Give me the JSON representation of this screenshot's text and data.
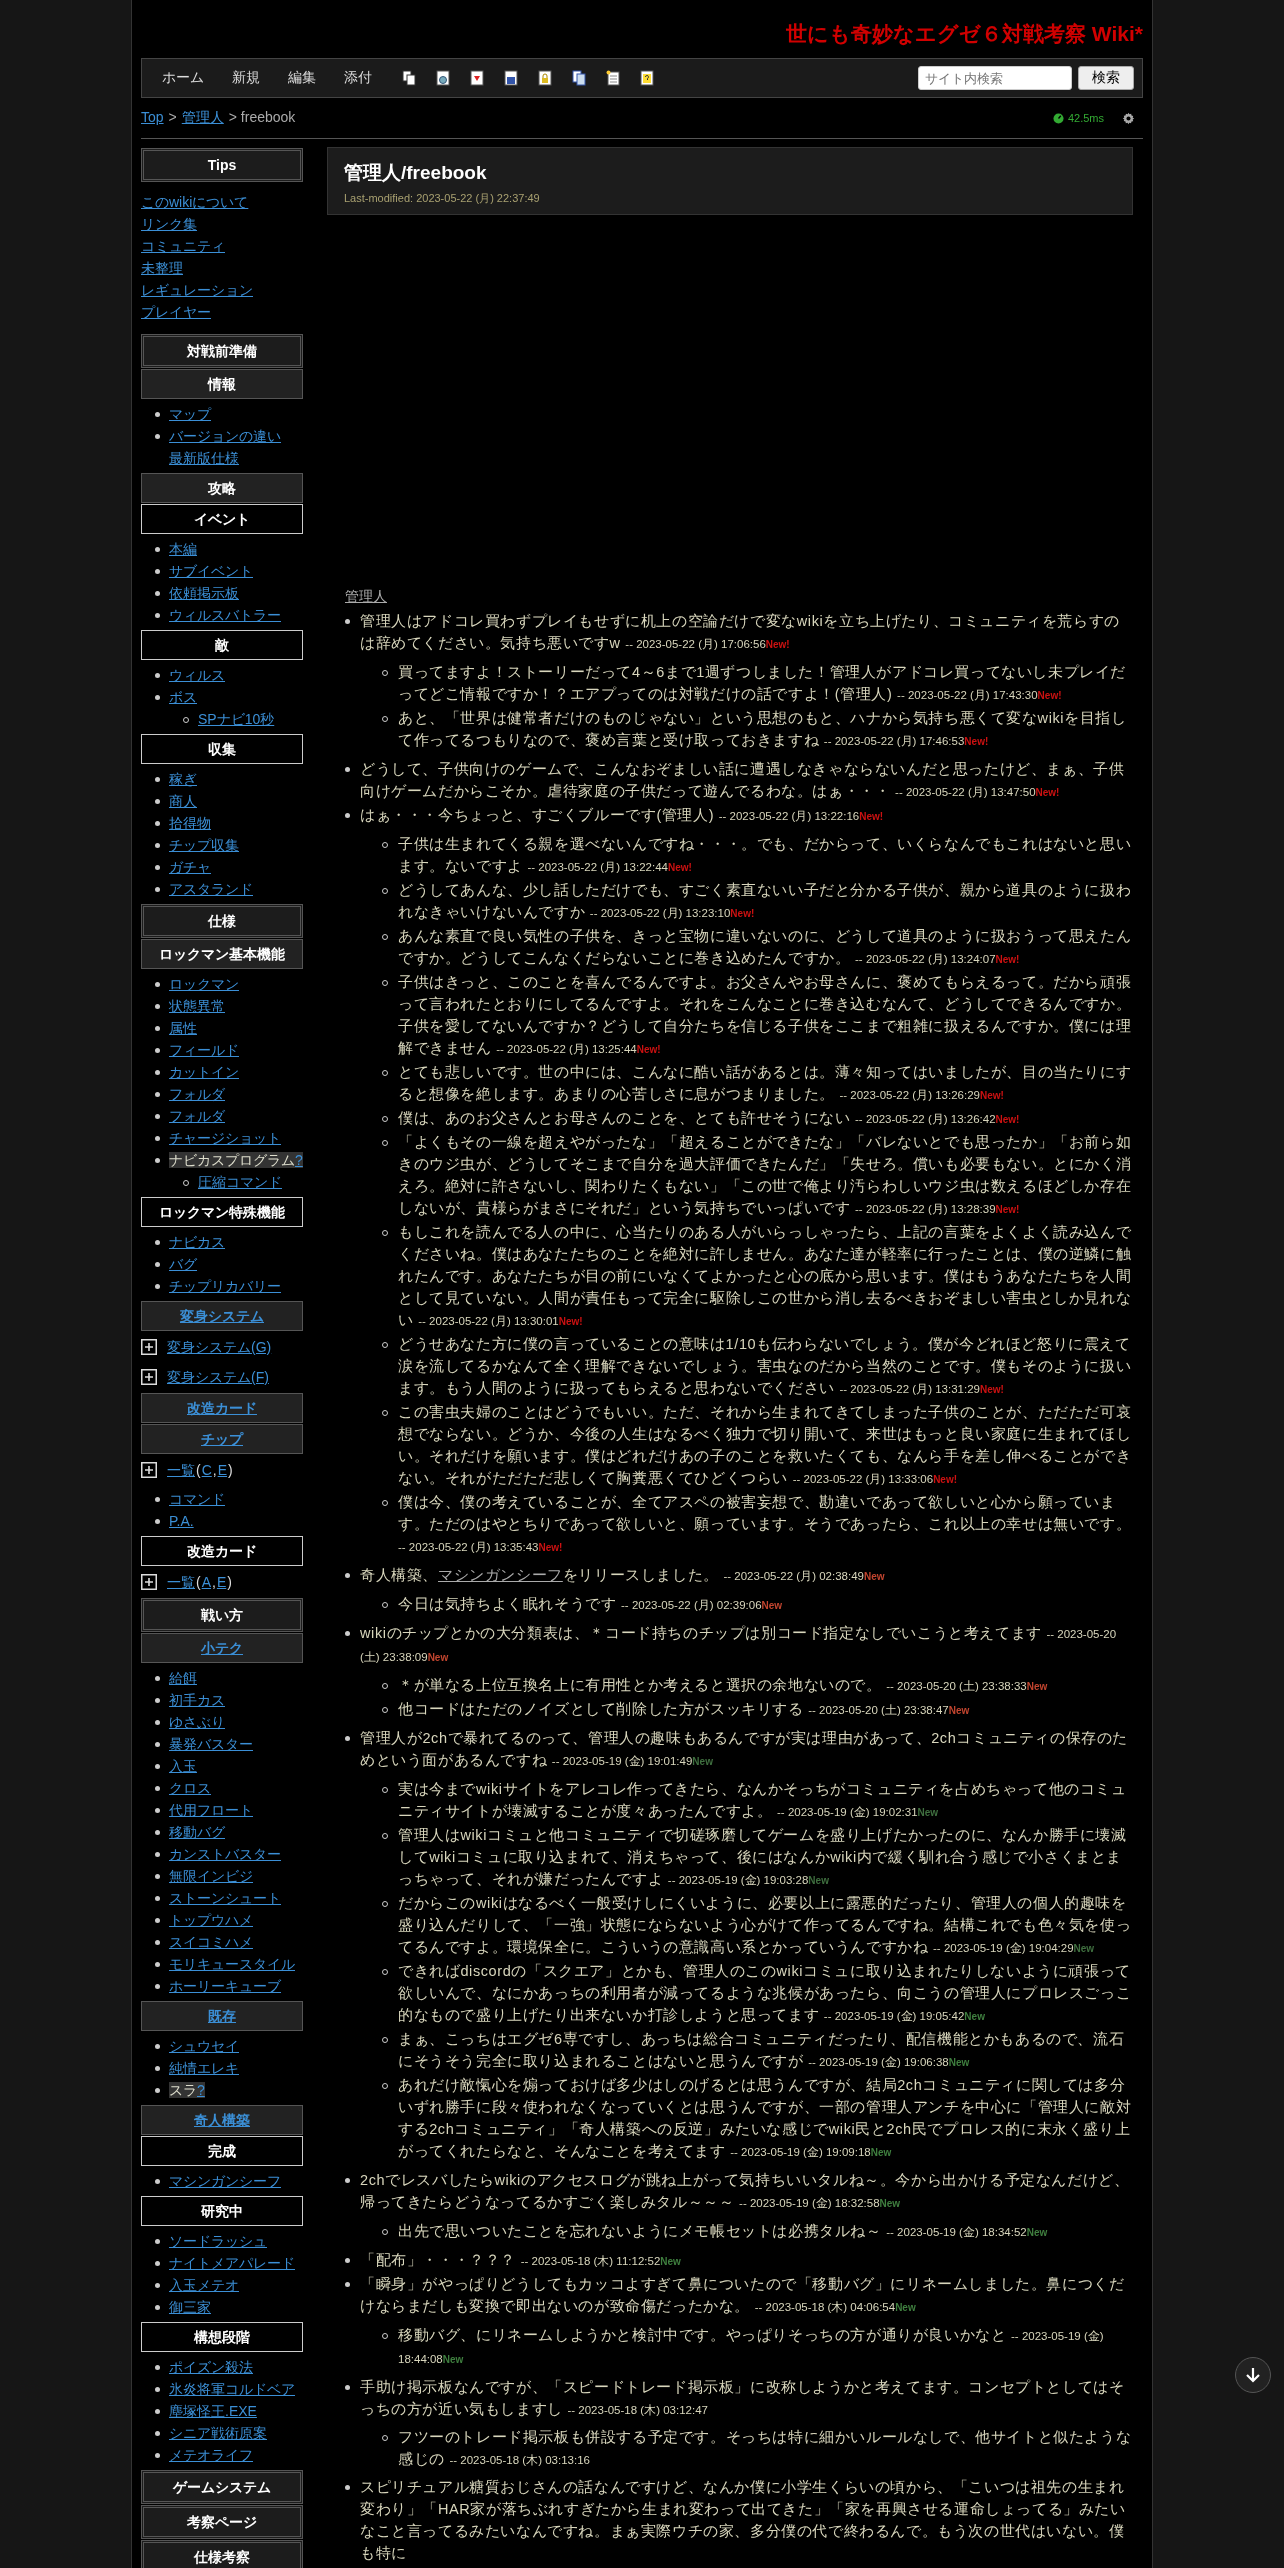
{
  "site_title": "世にも奇妙なエグゼ６対戦考察 Wiki*",
  "nav": {
    "links": [
      "ホーム",
      "新規",
      "編集",
      "添付"
    ],
    "search": {
      "placeholder": "サイト内検索",
      "button": "検索"
    }
  },
  "breadcrumb": [
    {
      "text": "Top",
      "link": true
    },
    {
      "text": ">",
      "link": false
    },
    {
      "text": "管理人",
      "link": true
    },
    {
      "text": "> freebook",
      "link": false
    }
  ],
  "timing": "42.5ms",
  "sidebar": [
    {
      "kind": "h2",
      "text": "Tips",
      "link": false
    },
    {
      "kind": "links",
      "items": [
        "このwikiについて",
        "リンク集",
        "コミュニティ",
        "未整理",
        "レギュレーション",
        "プレイヤー"
      ]
    },
    {
      "kind": "h2",
      "text": "対戦前準備",
      "link": false
    },
    {
      "kind": "h3",
      "text": "情報",
      "link": false
    },
    {
      "kind": "list",
      "items": [
        {
          "text": "マップ",
          "missing": false
        },
        {
          "text": "バージョンの違い",
          "missing": false,
          "more": [
            "最新版仕様"
          ]
        }
      ]
    },
    {
      "kind": "h3",
      "text": "攻略",
      "link": false
    },
    {
      "kind": "h4",
      "text": "イベント",
      "link": false
    },
    {
      "kind": "list",
      "items": [
        {
          "text": "本編",
          "missing": false
        },
        {
          "text": "サブイベント",
          "missing": false
        },
        {
          "text": "依頼掲示板",
          "missing": false
        },
        {
          "text": "ウィルスバトラー",
          "missing": false
        }
      ]
    },
    {
      "kind": "h4",
      "text": "敵",
      "link": false
    },
    {
      "kind": "list",
      "items": [
        {
          "text": "ウィルス",
          "missing": false
        },
        {
          "text": "ボス",
          "missing": false,
          "children": [
            {
              "text": "SPナビ10秒"
            }
          ]
        }
      ]
    },
    {
      "kind": "h4",
      "text": "収集",
      "link": false
    },
    {
      "kind": "list",
      "items": [
        {
          "text": "稼ぎ",
          "missing": false
        },
        {
          "text": "商人",
          "missing": false
        },
        {
          "text": "拾得物",
          "missing": false
        },
        {
          "text": "チップ収集",
          "missing": false
        },
        {
          "text": "ガチャ",
          "missing": false
        },
        {
          "text": "アスタランド",
          "missing": false
        }
      ]
    },
    {
      "kind": "h2",
      "text": "仕様",
      "link": false
    },
    {
      "kind": "h3",
      "text": "ロックマン基本機能",
      "link": false
    },
    {
      "kind": "list",
      "items": [
        {
          "text": "ロックマン",
          "missing": false
        },
        {
          "text": "状態異常",
          "missing": false
        },
        {
          "text": "属性",
          "missing": false
        },
        {
          "text": "フィールド",
          "missing": false
        },
        {
          "text": "カットイン",
          "missing": false
        },
        {
          "text": "フォルダ",
          "missing": false
        },
        {
          "text": "フォルダ",
          "missing": false
        },
        {
          "text": "チャージショット",
          "missing": false
        },
        {
          "text": "ナビカスプログラム",
          "missing": true,
          "mark": "?",
          "children": [
            {
              "text": "圧縮コマンド"
            }
          ]
        }
      ]
    },
    {
      "kind": "h4",
      "text": "ロックマン特殊機能",
      "link": false
    },
    {
      "kind": "list",
      "items": [
        {
          "text": "ナビカス",
          "missing": false
        },
        {
          "text": "バグ",
          "missing": false
        },
        {
          "text": "チップリカバリー",
          "missing": false
        }
      ]
    },
    {
      "kind": "h3",
      "text": "変身システム",
      "link": true
    },
    {
      "kind": "fold",
      "parts": [
        {
          "text": "変身システム(G)",
          "link": true
        }
      ]
    },
    {
      "kind": "fold",
      "parts": [
        {
          "text": "変身システム(F)",
          "link": true
        }
      ]
    },
    {
      "kind": "h3",
      "text": "改造カード",
      "link": true
    },
    {
      "kind": "h3",
      "text": "チップ",
      "link": true
    },
    {
      "kind": "fold",
      "parts": [
        {
          "text": "一覧",
          "link": true
        },
        {
          "text": "(",
          "link": false
        },
        {
          "text": "C",
          "link": true
        },
        {
          "text": ",",
          "link": false
        },
        {
          "text": "E",
          "link": true
        },
        {
          "text": ")",
          "link": false
        }
      ]
    },
    {
      "kind": "list",
      "items": [
        {
          "text": "コマンド",
          "missing": false
        },
        {
          "text": "P.A.",
          "missing": false
        }
      ]
    },
    {
      "kind": "h4",
      "text": "改造カード",
      "link": false
    },
    {
      "kind": "fold",
      "parts": [
        {
          "text": "一覧",
          "link": true
        },
        {
          "text": "(",
          "link": false
        },
        {
          "text": "A",
          "link": true
        },
        {
          "text": ",",
          "link": false
        },
        {
          "text": "E",
          "link": true
        },
        {
          "text": ")",
          "link": false
        }
      ]
    },
    {
      "kind": "h2",
      "text": "戦い方",
      "link": false
    },
    {
      "kind": "h3",
      "text": "小テク",
      "link": true
    },
    {
      "kind": "list",
      "items": [
        {
          "text": "給餌",
          "missing": false
        },
        {
          "text": "初手カス",
          "missing": false
        },
        {
          "text": "ゆさぶり",
          "missing": false
        },
        {
          "text": "暴発バスター",
          "missing": false
        },
        {
          "text": "入玉",
          "missing": false
        },
        {
          "text": "クロス",
          "missing": false
        },
        {
          "text": "代用フロート",
          "missing": false
        },
        {
          "text": "移動バグ",
          "missing": false
        },
        {
          "text": "カンストバスター",
          "missing": false
        },
        {
          "text": "無限インビジ",
          "missing": false
        },
        {
          "text": "ストーンシュート",
          "missing": false
        },
        {
          "text": "トップウハメ",
          "missing": false
        },
        {
          "text": "スイコミハメ",
          "missing": false
        },
        {
          "text": "モリキュースタイル",
          "missing": false
        },
        {
          "text": "ホーリーキューブ",
          "missing": false
        }
      ]
    },
    {
      "kind": "h3",
      "text": "既存",
      "link": true
    },
    {
      "kind": "list",
      "items": [
        {
          "text": "シュウセイ",
          "missing": false
        },
        {
          "text": "純情エレキ",
          "missing": false
        },
        {
          "text": "スラ",
          "missing": true,
          "mark": "?"
        }
      ]
    },
    {
      "kind": "h3",
      "text": "奇人構築",
      "link": true
    },
    {
      "kind": "h4",
      "text": "完成",
      "link": false
    },
    {
      "kind": "list",
      "items": [
        {
          "text": "マシンガンシーフ",
          "missing": false
        }
      ]
    },
    {
      "kind": "h4",
      "text": "研究中",
      "link": false
    },
    {
      "kind": "list",
      "items": [
        {
          "text": "ソードラッシュ",
          "missing": false
        },
        {
          "text": "ナイトメアパレード",
          "missing": false
        },
        {
          "text": "入玉メテオ",
          "missing": false
        },
        {
          "text": "御三家",
          "missing": false
        }
      ]
    },
    {
      "kind": "h4",
      "text": "構想段階",
      "link": false
    },
    {
      "kind": "list",
      "items": [
        {
          "text": "ポイズン殺法",
          "missing": false
        },
        {
          "text": "氷炎将軍コルドベア",
          "missing": false
        },
        {
          "text": "塵塚怪王.EXE",
          "missing": false
        },
        {
          "text": "シニア戦術原案",
          "missing": false
        },
        {
          "text": "メテオライフ",
          "missing": false
        }
      ]
    },
    {
      "kind": "h2",
      "text": "ゲームシステム",
      "link": false
    },
    {
      "kind": "h2",
      "text": "考察ページ",
      "link": false
    },
    {
      "kind": "h2",
      "text": "仕様考察",
      "link": false
    }
  ],
  "page": {
    "title": "管理人/freebook",
    "modified": "Last-modified: 2023-05-22 (月) 22:37:49"
  },
  "section_link": "管理人",
  "comments": [
    {
      "text": "管理人はアドコレ買わずプレイもせずに机上の空論だけで変なwikiを立ち上げたり、コミュニティを荒らすのは辞めてください。気持ち悪いですw",
      "date": "-- 2023-05-22 (月) 17:06:56",
      "badge": "New!",
      "color": "#cc1111",
      "children": [
        {
          "text": "買ってますよ！ストーリーだって4～6まで1週ずつしました！管理人がアドコレ買ってないし未プレイだってどこ情報ですか！？エアプってのは対戦だけの話ですよ！(管理人)",
          "date": "-- 2023-05-22 (月) 17:43:30",
          "badge": "New!",
          "color": "#cc1111"
        },
        {
          "text": "あと、「世界は健常者だけのものじゃない」という思想のもと、ハナから気持ち悪くて変なwikiを目指して作ってるつもりなので、褒め言葉と受け取っておきますね",
          "date": "-- 2023-05-22 (月) 17:46:53",
          "badge": "New!",
          "color": "#cc1111"
        }
      ]
    },
    {
      "text": "どうして、子供向けのゲームで、こんなおぞましい話に遭遇しなきゃならないんだと思ったけど、まぁ、子供向けゲームだからこそか。虐待家庭の子供だって遊んでるわな。はぁ・・・",
      "date": "-- 2023-05-22 (月) 13:47:50",
      "badge": "New!",
      "color": "#cc1111"
    },
    {
      "text": "はぁ・・・今ちょっと、すごくブルーです(管理人)",
      "date": "-- 2023-05-22 (月) 13:22:16",
      "badge": "New!",
      "color": "#cc1111",
      "children": [
        {
          "text": "子供は生まれてくる親を選べないんですね・・・。でも、だからって、いくらなんでもこれはないと思います。ないですよ",
          "date": "-- 2023-05-22 (月) 13:22:44",
          "badge": "New!",
          "color": "#cc1111"
        },
        {
          "text": "どうしてあんな、少し話しただけでも、すごく素直ないい子だと分かる子供が、親から道具のように扱われなきゃいけないんですか",
          "date": "-- 2023-05-22 (月) 13:23:10",
          "badge": "New!",
          "color": "#cc1111"
        },
        {
          "text": "あんな素直で良い気性の子供を、きっと宝物に違いないのに、どうして道具のように扱おうって思えたんですか。どうしてこんなくだらないことに巻き込めたんですか。",
          "date": "-- 2023-05-22 (月) 13:24:07",
          "badge": "New!",
          "color": "#cc1111"
        },
        {
          "text": "子供はきっと、このことを喜んでるんですよ。お父さんやお母さんに、褒めてもらえるって。だから頑張って言われたとおりにしてるんですよ。それをこんなことに巻き込むなんて、どうしてできるんですか。子供を愛してないんですか？どうして自分たちを信じる子供をここまで粗雑に扱えるんですか。僕には理解できません",
          "date": "-- 2023-05-22 (月) 13:25:44",
          "badge": "New!",
          "color": "#cc1111"
        },
        {
          "text": "とても悲しいです。世の中には、こんなに酷い話があるとは。薄々知ってはいましたが、目の当たりにすると想像を絶します。あまりの心苦しさに息がつまりました。",
          "date": "-- 2023-05-22 (月) 13:26:29",
          "badge": "New!",
          "color": "#cc1111"
        },
        {
          "text": "僕は、あのお父さんとお母さんのことを、とても許せそうにない",
          "date": "-- 2023-05-22 (月) 13:26:42",
          "badge": "New!",
          "color": "#cc1111"
        },
        {
          "text": "「よくもその一線を超えやがったな」「超えることができたな」「バレないとでも思ったか」「お前ら如きのウジ虫が、どうしてそこまで自分を過大評価できたんだ」「失せろ。償いも必要もない。とにかく消えろ。絶対に許さないし、関わりたくもない」「この世で俺より汚らわしいウジ虫は数えるほどしか存在しないが、貴様らがまさにそれだ」という気持ちでいっぱいです",
          "date": "-- 2023-05-22 (月) 13:28:39",
          "badge": "New!",
          "color": "#cc1111"
        },
        {
          "text": "もしこれを読んでる人の中に、心当たりのある人がいらっしゃったら、上記の言葉をよくよく読み込んでくださいね。僕はあなたたちのことを絶対に許しません。あなた達が軽率に行ったことは、僕の逆鱗に触れたんです。あなたたちが目の前にいなくてよかったと心の底から思います。僕はもうあなたたちを人間として見ていない。人間が責任もって完全に駆除しこの世から消し去るべきおぞましい害虫としか見れない",
          "date": "-- 2023-05-22 (月) 13:30:01",
          "badge": "New!",
          "color": "#cc1111"
        },
        {
          "text": "どうせあなた方に僕の言っていることの意味は1/10も伝わらないでしょう。僕が今どれほど怒りに震えて涙を流してるかなんて全く理解できないでしょう。害虫なのだから当然のことです。僕もそのように扱います。もう人間のように扱ってもらえると思わないでください",
          "date": "-- 2023-05-22 (月) 13:31:29",
          "badge": "New!",
          "color": "#cc1111"
        },
        {
          "text": "この害虫夫婦のことはどうでもいい。ただ、それから生まれてきてしまった子供のことが、ただただ可哀想でならない。どうか、今後の人生はなるべく独力で切り開いて、来世はもっと良い家庭に生まれてほしい。それだけを願います。僕はどれだけあの子のことを救いたくても、なんら手を差し伸べることができない。それがただただ悲しくて胸糞悪くてひどくつらい",
          "date": "-- 2023-05-22 (月) 13:33:06",
          "badge": "New!",
          "color": "#cc1111"
        },
        {
          "text": "僕は今、僕の考えていることが、全てアスペの被害妄想で、勘違いであって欲しいと心から願っています。ただのはやとちりであって欲しいと、願っています。そうであったら、これ以上の幸せは無いです。",
          "date": "-- 2023-05-22 (月) 13:35:43",
          "badge": "New!",
          "color": "#cc1111"
        }
      ]
    },
    {
      "text": "奇人構築、",
      "link": "マシンガンシーフ",
      "after": "をリリースしました。",
      "date": "-- 2023-05-22 (月) 02:38:49",
      "badge": "New",
      "color": "#c2452f",
      "children": [
        {
          "text": "今日は気持ちよく眠れそうです",
          "date": "-- 2023-05-22 (月) 02:39:06",
          "badge": "New",
          "color": "#c2452f"
        }
      ]
    },
    {
      "text": "wikiのチップとかの大分類表は、＊コード持ちのチップは別コード指定なしでいこうと考えてます",
      "date": "-- 2023-05-20 (土) 23:38:09",
      "badge": "New",
      "color": "#c2452f",
      "children": [
        {
          "text": "＊が単なる上位互換名上に有用性とか考えると選択の余地ないので。",
          "date": "-- 2023-05-20 (土) 23:38:33",
          "badge": "New",
          "color": "#c2452f"
        },
        {
          "text": "他コードはただのノイズとして削除した方がスッキリする",
          "date": "-- 2023-05-20 (土) 23:38:47",
          "badge": "New",
          "color": "#c2452f"
        }
      ]
    },
    {
      "text": "管理人が2chで暴れてるのって、管理人の趣味もあるんですが実は理由があって、2chコミュニティの保存のためという面があるんですね",
      "date": "-- 2023-05-19 (金) 19:01:49",
      "badge": "New",
      "color": "#3f6f3f",
      "children": [
        {
          "text": "実は今までwikiサイトをアレコレ作ってきたら、なんかそっちがコミュニティを占めちゃって他のコミュニティサイトが壊滅することが度々あったんですよ。",
          "date": "-- 2023-05-19 (金) 19:02:31",
          "badge": "New",
          "color": "#3f6f3f"
        },
        {
          "text": "管理人はwikiコミュと他コミュニティで切磋琢磨してゲームを盛り上げたかったのに、なんか勝手に壊滅してwikiコミュに取り込まれて、消えちゃって、後にはなんかwiki内で緩く馴れ合う感じで小さくまとまっちゃって、それが嫌だったんですよ",
          "date": "-- 2023-05-19 (金) 19:03:28",
          "badge": "New",
          "color": "#3f6f3f"
        },
        {
          "text": "だからこのwikiはなるべく一般受けしにくいように、必要以上に露悪的だったり、管理人の個人的趣味を盛り込んだりして、「一強」状態にならないよう心がけて作ってるんですね。結構これでも色々気を使ってるんですよ。環境保全に。こういうの意識高い系とかっていうんですかね",
          "date": "-- 2023-05-19 (金) 19:04:29",
          "badge": "New",
          "color": "#3f6f3f"
        },
        {
          "text": "できればdiscordの「スクエア」とかも、管理人のこのwikiコミュに取り込まれたりしないように頑張って欲しいんで、なにかあっちの利用者が減ってるような兆候があったら、向こうの管理人にプロレスごっこ的なもので盛り上げたり出来ないか打診しようと思ってます",
          "date": "-- 2023-05-19 (金) 19:05:42",
          "badge": "New",
          "color": "#3f7f3f"
        },
        {
          "text": "まぁ、こっちはエグゼ6専ですし、あっちは総合コミュニティだったり、配信機能とかもあるので、流石にそうそう完全に取り込まれることはないと思うんですが",
          "date": "-- 2023-05-19 (金) 19:06:38",
          "badge": "New",
          "color": "#3f7f3f"
        },
        {
          "text": "あれだけ敵愾心を煽っておけば多少はしのげるとは思うんですが、結局2chコミュニティに関しては多分いずれ勝手に段々使われなくなっていくとは思うんですが、一部の管理人アンチを中心に「管理人に敵対する2chコミュニティ」「奇人構築への反逆」みたいな感じでwiki民と2ch民でプロレス的に末永く盛り上がってくれたらなと、そんなことを考えてます",
          "date": "-- 2023-05-19 (金) 19:09:18",
          "badge": "New",
          "color": "#3f7f3f"
        }
      ]
    },
    {
      "text": "2chでレスバしたらwikiのアクセスログが跳ね上がって気持ちいいタルね～。今から出かける予定なんだけど、帰ってきたらどうなってるかすごく楽しみタル～～～",
      "date": "-- 2023-05-19 (金) 18:32:58",
      "badge": "New",
      "color": "#3f7f3f",
      "children": [
        {
          "text": "出先で思いついたことを忘れないようにメモ帳セットは必携タルね～",
          "date": "-- 2023-05-19 (金) 18:34:52",
          "badge": "New",
          "color": "#3f7f3f"
        }
      ]
    },
    {
      "text": "「配布」・・・？？？",
      "date": "-- 2023-05-18 (木) 11:12:52",
      "badge": "New",
      "color": "#3f7f3f"
    },
    {
      "text": "「瞬身」がやっぱりどうしてもカッコよすぎて鼻についたので「移動バグ」にリネームしました。鼻につくだけならまだしも変換で即出ないのが致命傷だったかな。",
      "date": "-- 2023-05-18 (木) 04:06:54",
      "badge": "New",
      "color": "#3f7f3f",
      "children": [
        {
          "text": "移動バグ、にリネームしようかと検討中です。やっぱりそっちの方が通りが良いかなと",
          "date": "-- 2023-05-19 (金) 18:44:08",
          "badge": "New",
          "color": "#3f7f3f"
        }
      ]
    },
    {
      "text": "手助け掲示板なんですが、「スピードトレード掲示板」に改称しようかと考えてます。コンセプトとしてはそっちの方が近い気もしますし",
      "date": "-- 2023-05-18 (木) 03:12:47",
      "children": [
        {
          "text": "フツーのトレード掲示板も併設する予定です。そっちは特に細かいルールなしで、他サイトと似たような感じの",
          "date": "-- 2023-05-18 (木) 03:13:16"
        }
      ]
    },
    {
      "text": "スピリチュアル糖質おじさんの話なんですけど、なんか僕に小学生くらいの頃から、「こいつは祖先の生まれ変わり」「HAR家が落ちぶれすぎたから生まれ変わって出てきた」「家を再興させる運命しょってる」みたいなこと言ってるみたいなんですね。まぁ実際ウチの家、多分僕の代で終わるんで。もう次の世代はいない。僕も特に"
    }
  ]
}
